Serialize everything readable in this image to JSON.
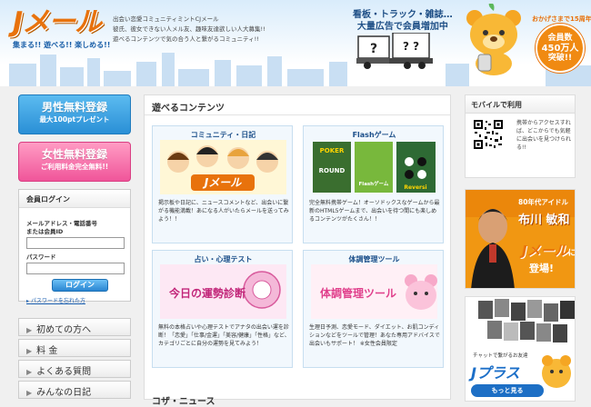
{
  "header": {
    "logo_text": "Jメール",
    "logo_tagline": "集まる!! 遊べる!! 楽しめる!!",
    "intro_lines": [
      "出会い恋愛コミュニティミントCJメール",
      "彼氏、彼女できない人メル友、趣味友達欲しい人大募集!!",
      "遊べるコンテンツで気の合う人と繋がるコミュニティ!!"
    ],
    "ad_line1": "看板・トラック・雑誌…",
    "ad_line2": "大量広告で会員増加中",
    "truck_sign1": "?",
    "truck_sign2": "? ?",
    "badge_top": "おかげさまで15周年",
    "badge_line1": "会員数",
    "badge_line2": "450万人",
    "badge_line3": "突破!!"
  },
  "left": {
    "male_reg_title": "男性無料登録",
    "male_reg_sub": "最大100ptプレゼント",
    "female_reg_title": "女性無料登録",
    "female_reg_sub": "ご利用料金完全無料!!",
    "login_title": "会員ログイン",
    "email_label1": "メールアドレス・電話番号",
    "email_label2": "または会員ID",
    "password_label": "パスワード",
    "login_button": "ログイン",
    "forgot_link": "パスワードを忘れた方",
    "nav": [
      "初めての方へ",
      "料 金",
      "よくある質問",
      "みんなの日記"
    ]
  },
  "center": {
    "section_title": "遊べるコンテンツ",
    "cards": [
      {
        "title": "コミュニティ・日記",
        "desc": "掲示板や日記に、ニュースコメントなど、出会いに繋がる機能満載！あになる人がいたらメールを送ってみよう！！"
      },
      {
        "title": "Flashゲーム",
        "desc": "完全無料携帯ゲーム！オーソドックスなゲームから最新のHTML5ゲームまで、出会いを待つ間にも楽しめるコンテンツがたくさん！！"
      },
      {
        "title": "占い・心理テスト",
        "desc": "無料の本格占いや心理テストでアナタの出会い運を診断！「恋愛」「仕事/金運」「美容/健康」「性格」など、カテゴリごとに自分の運勢を見てみよう！"
      },
      {
        "title": "体調管理ツール",
        "desc": "生理日予測、恋愛モード、ダイエット、お肌コンディションなどをツールで管理！あなた専用アドバイスで出会いもサポート！ ※女性会員限定"
      }
    ],
    "card_images": {
      "game1": "POKER",
      "game1b": "ROUND",
      "game2": "Flashゲーム",
      "game3": "Reversi",
      "fortune": "今日の運勢診断",
      "health": "体調管理ツール"
    },
    "section2_title": "コザ・ニュース"
  },
  "right": {
    "mobile_title": "モバイルで利用",
    "mobile_text": "携帯からアクセスすれば、どこからでも気軽に出会いを見つけられる!!",
    "banner1_line": "80年代アイドル",
    "banner1_name": "布川 敏和",
    "banner1_logo": "Jメール",
    "banner1_logo_suffix": "に",
    "banner1_stage": "登場!",
    "banner2_caption": "チャットで繋がるお友達",
    "banner2_logo": "Jプラス",
    "banner2_more": "もっと見る"
  },
  "colors": {
    "brand_orange": "#e8720c",
    "male_blue": "#2a8fd6",
    "female_pink": "#f0559a",
    "nav_blue": "#1c4f8a"
  }
}
